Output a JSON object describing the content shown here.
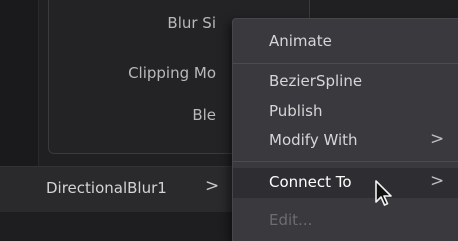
{
  "inspector": {
    "properties": [
      {
        "label": "Blur Si"
      },
      {
        "label": "Clipping Mo"
      },
      {
        "label": "Ble"
      }
    ]
  },
  "node": {
    "name": "DirectionalBlur1",
    "chevron": ">"
  },
  "context_menu": {
    "items": [
      {
        "label": "Animate",
        "submenu": false,
        "state": "normal"
      },
      {
        "label": "BezierSpline",
        "submenu": false,
        "state": "normal"
      },
      {
        "label": "Publish",
        "submenu": false,
        "state": "normal"
      },
      {
        "label": "Modify With",
        "submenu": true,
        "arrow": ">",
        "state": "normal"
      },
      {
        "label": "Connect To",
        "submenu": true,
        "arrow": ">",
        "state": "highlighted"
      },
      {
        "label": "Edit...",
        "submenu": false,
        "state": "disabled"
      }
    ]
  },
  "colors": {
    "menu_background": "#3a3a3e",
    "highlight": "#2e2e32",
    "disabled_text": "#6d6d70"
  }
}
